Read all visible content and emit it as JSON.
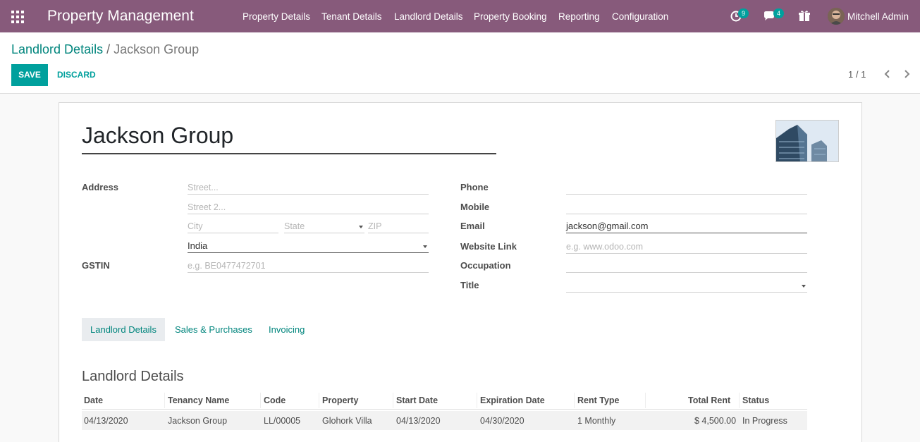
{
  "navbar": {
    "brand": "Property Management",
    "menu": [
      "Property Details",
      "Tenant Details",
      "Landlord Details",
      "Property Booking",
      "Reporting",
      "Configuration"
    ],
    "activity_badge": "9",
    "messages_badge": "4",
    "user": "Mitchell Admin",
    "icons": [
      "apps-grid-icon",
      "activity-clock-icon",
      "chat-icon",
      "gift-icon"
    ]
  },
  "breadcrumb": {
    "parent": "Landlord Details",
    "separator": "/",
    "current": "Jackson Group"
  },
  "actions": {
    "save": "SAVE",
    "discard": "DISCARD"
  },
  "pager": {
    "value": "1 / 1"
  },
  "form": {
    "name": "Jackson Group",
    "address_label": "Address",
    "street_placeholder": "Street...",
    "street2_placeholder": "Street 2...",
    "city_placeholder": "City",
    "state_placeholder": "State",
    "zip_placeholder": "ZIP",
    "country": "India",
    "gstin_label": "GSTIN",
    "gstin_placeholder": "e.g. BE0477472701",
    "phone_label": "Phone",
    "phone": "",
    "mobile_label": "Mobile",
    "mobile": "",
    "email_label": "Email",
    "email": "jackson@gmail.com",
    "website_label": "Website Link",
    "website_placeholder": "e.g. www.odoo.com",
    "occupation_label": "Occupation",
    "occupation": "",
    "title_label": "Title",
    "title": ""
  },
  "tabs": [
    "Landlord Details",
    "Sales & Purchases",
    "Invoicing"
  ],
  "section_title": "Landlord Details",
  "table": {
    "columns": [
      "Date",
      "Tenancy Name",
      "Code",
      "Property",
      "Start Date",
      "Expiration Date",
      "Rent Type",
      "Total Rent",
      "Status"
    ],
    "rows": [
      [
        "04/13/2020",
        "Jackson Group",
        "LL/00005",
        "Glohork Villa",
        "04/13/2020",
        "04/30/2020",
        "1 Monthly",
        "$ 4,500.00",
        "In Progress"
      ]
    ]
  },
  "colors": {
    "navbar": "#875a7b",
    "accent": "#00a09d",
    "link": "#00857d"
  }
}
